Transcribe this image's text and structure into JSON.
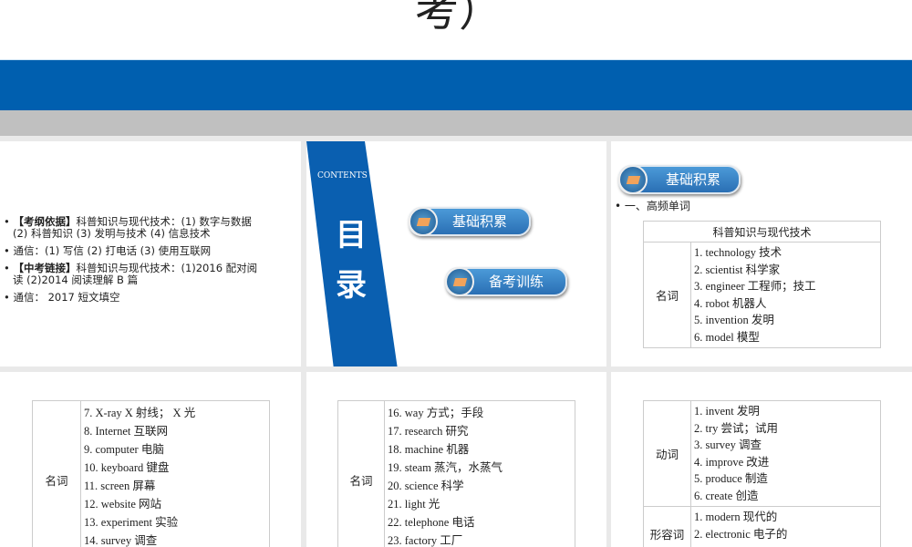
{
  "top_title": "考）",
  "slide1": {
    "bullets": [
      {
        "bold": "【考纲依据】",
        "text": "科普知识与现代技术：(1) 数字与数据 (2) 科普知识 (3) 发明与技术 (4) 信息技术"
      },
      {
        "bold": "",
        "text": "通信：(1) 写信 (2) 打电话 (3) 使用互联网"
      },
      {
        "bold": "【中考链接】",
        "text": "科普知识与现代技术：(1)2016 配对阅读 (2)2014 阅读理解 B 篇"
      },
      {
        "bold": "",
        "text": "通信： 2017 短文填空"
      }
    ]
  },
  "slide2": {
    "contents": "CONTENTS",
    "mu": "目",
    "lu": "录",
    "btn1": "基础积累",
    "btn2": "备考训练"
  },
  "slide3": {
    "section": "基础积累",
    "subtitle": "• 一、高频单词",
    "table_header": "科普知识与现代技术",
    "label": "名词",
    "items": [
      "1. technology 技术",
      "2. scientist 科学家",
      "3. engineer 工程师；技工",
      "4. robot 机器人",
      "5. invention 发明",
      "6. model 模型"
    ]
  },
  "slide4": {
    "label": "名词",
    "items": [
      "7. X-ray X 射线； X 光",
      "8. Internet 互联网",
      "9. computer 电脑",
      "10. keyboard 键盘",
      "11. screen 屏幕",
      "12. website 网站",
      "13. experiment 实验",
      "14. survey 调查"
    ]
  },
  "slide5": {
    "label": "名词",
    "items": [
      "16. way 方式；手段",
      "17. research 研究",
      "18. machine 机器",
      "19. steam 蒸汽，水蒸气",
      "20. science 科学",
      "21. light 光",
      "22. telephone 电话",
      "23. factory 工厂"
    ]
  },
  "slide6": {
    "verb_label": "动词",
    "verbs": [
      "1. invent 发明",
      "2. try 尝试；试用",
      "3. survey 调查",
      "4. improve 改进",
      "5. produce 制造",
      "6. create 创造"
    ],
    "adj_label": "形容词",
    "adjs": [
      "1. modern 现代的",
      "2. electronic 电子的"
    ]
  }
}
